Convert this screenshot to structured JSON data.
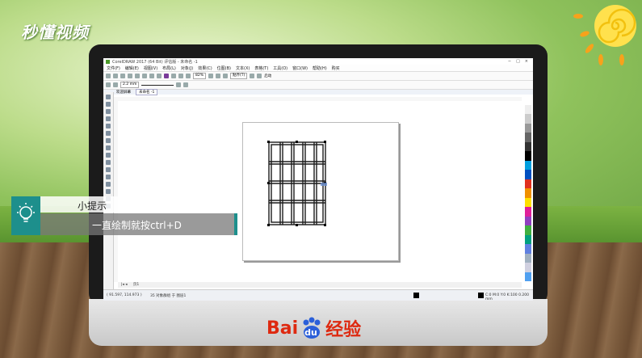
{
  "brand": {
    "logo_text": "秒懂视频"
  },
  "footer": {
    "logo_bai": "Bai",
    "logo_du": "du",
    "logo_jingyan": "经验"
  },
  "app": {
    "title": "CorelDRAW 2017 (64 Bit) 评估版 - 未命名 -1",
    "window_controls": [
      "−",
      "□",
      "×"
    ],
    "menu": [
      "文件(F)",
      "编辑(E)",
      "视图(V)",
      "布局(L)",
      "对象(J)",
      "效果(C)",
      "位图(B)",
      "文本(X)",
      "表格(T)",
      "工具(O)",
      "窗口(W)",
      "帮助(H)",
      "购买"
    ],
    "toolbar": {
      "zoom": "82%",
      "snap": "贴齐(T)",
      "launch": "启动"
    },
    "propbar": {
      "outline_width": "2.2 mm"
    },
    "tabs": {
      "welcome": "欢迎屏幕",
      "doc": "未命名 -1"
    },
    "page_nav": {
      "page_label": "页1"
    },
    "status": {
      "coords": "( 91.597, 114.973 )",
      "selection": "35 对象群组 于 图层1",
      "fill": "C:0 M:0 Y:0 K:100  0.200 mm"
    }
  },
  "tip": {
    "title": "小提示",
    "body": "一直绘制就按ctrl+D"
  },
  "colors": {
    "accent": "#1d8f8c",
    "baidu_red": "#de2910",
    "baidu_blue": "#2b5fd9"
  }
}
